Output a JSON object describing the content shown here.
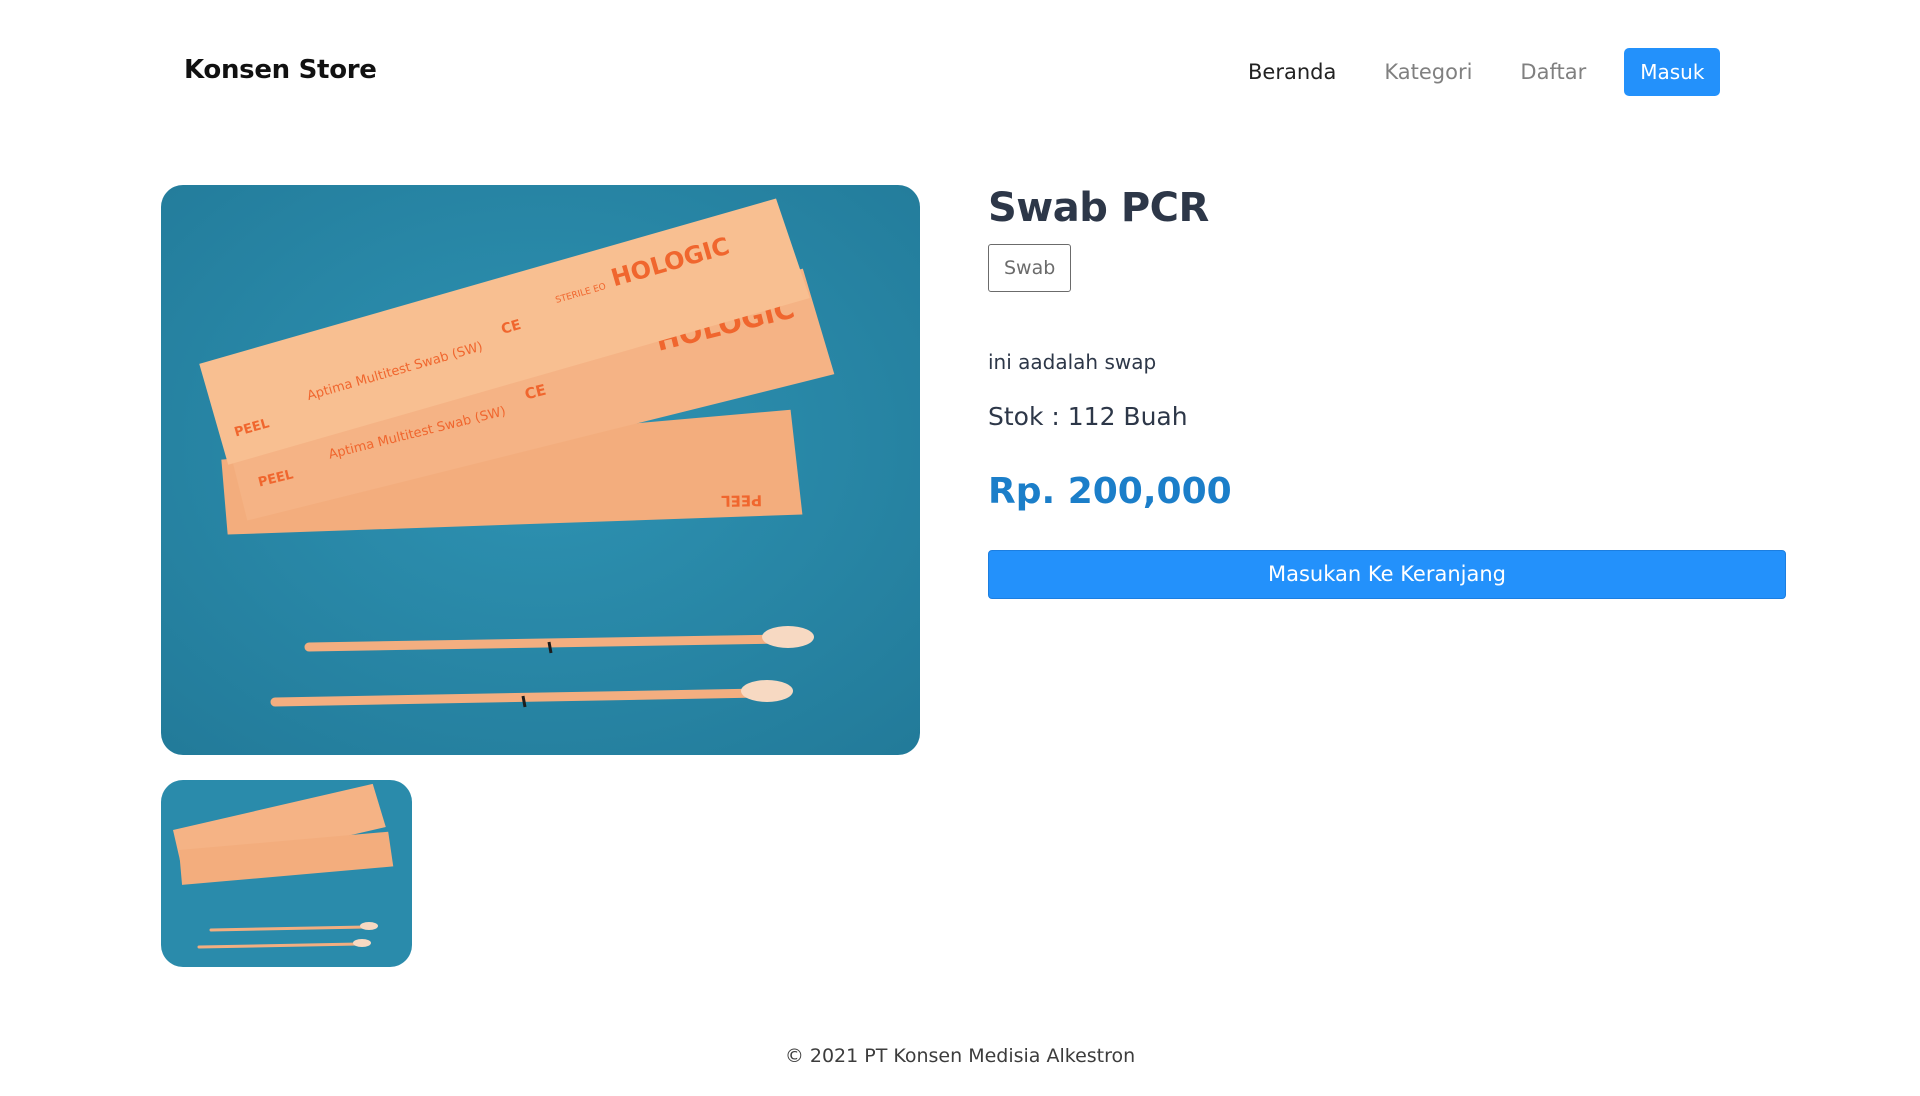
{
  "brand": {
    "name": "Konsen Store"
  },
  "nav": {
    "links": [
      {
        "label": "Beranda",
        "active": true
      },
      {
        "label": "Kategori",
        "active": false
      },
      {
        "label": "Daftar",
        "active": false
      }
    ],
    "login_label": "Masuk"
  },
  "product": {
    "title": "Swab PCR",
    "category": "Swab",
    "description": "ini aadalah swap",
    "stock": "Stok : 112 Buah",
    "price": "Rp. 200,000",
    "add_to_cart_label": "Masukan Ke Keranjang",
    "image_text": {
      "brand": "HOLOGIC",
      "peel": "PEEL",
      "product_line": "Aptima Multitest Swab (SW)",
      "ce_mark": "CE",
      "sterile": "STERILE EO"
    }
  },
  "colors": {
    "accent": "#2391fb",
    "price": "#1b7ec9",
    "image_bg": "#2a8bab",
    "packet": "#f7b98a",
    "packet_text": "#f0662e"
  },
  "footer": {
    "copyright": "© 2021 PT Konsen Medisia Alkestron"
  }
}
